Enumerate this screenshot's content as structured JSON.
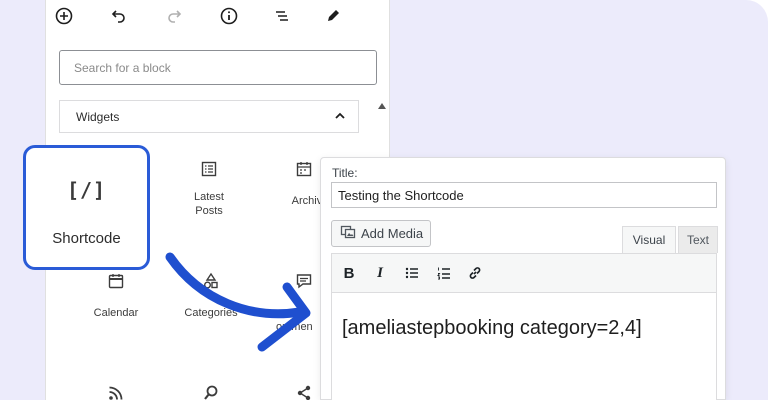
{
  "toolbar": {
    "icons": [
      "plus-circle-icon",
      "undo-icon",
      "redo-icon",
      "info-icon",
      "list-view-icon",
      "edit-icon"
    ]
  },
  "inserter": {
    "search_placeholder": "Search for a block",
    "category_label": "Widgets",
    "blocks": [
      {
        "label": "Shortcode",
        "icon": "shortcode-icon"
      },
      {
        "label": "Latest\nPosts",
        "line1": "Latest",
        "line2": "Posts",
        "icon": "latest-posts-icon"
      },
      {
        "label": "Archives",
        "visible": "Archive",
        "icon": "archives-icon"
      },
      {
        "label": "Calendar",
        "icon": "calendar-icon"
      },
      {
        "label": "Categories",
        "icon": "categories-icon"
      },
      {
        "label": "Latest Comments",
        "visible1": "atest",
        "visible2": "ommen",
        "icon": "comments-icon"
      },
      {
        "label": "",
        "icon": "rss-icon"
      },
      {
        "label": "",
        "icon": "search-icon"
      },
      {
        "label": "",
        "icon": "share-icon"
      }
    ],
    "shortcode_glyph": "[/]"
  },
  "editor": {
    "title_label": "Title:",
    "title_value": "Testing the Shortcode",
    "add_media_label": "Add Media",
    "tabs": [
      {
        "label": "Visual",
        "active": true
      },
      {
        "label": "Text",
        "active": false
      }
    ],
    "format_buttons": [
      "bold-icon",
      "italic-icon",
      "bullet-list-icon",
      "numbered-list-icon",
      "link-icon"
    ],
    "bold_glyph": "B",
    "italic_glyph": "I",
    "content": "[ameliastepbooking category=2,4]"
  },
  "colors": {
    "background": "#ecebfb",
    "accent": "#2a5bd7",
    "arrow": "#1f4fcf"
  }
}
